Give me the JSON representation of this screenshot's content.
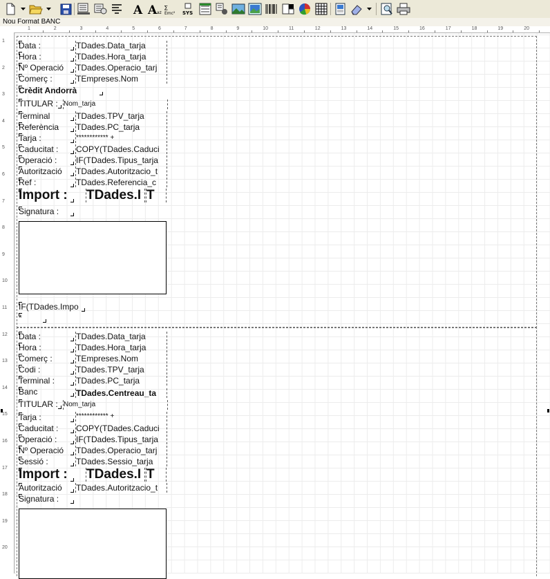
{
  "window": {
    "title": "Nou Format BANC"
  },
  "toolbar": {
    "icons": [
      "new-document-icon",
      "dropdown-arrow-icon",
      "open-folder-icon",
      "dropdown-arrow-icon",
      "save-icon",
      "report-properties-icon",
      "database-icon",
      "text-label-icon",
      "font-icon",
      "font-size-icon",
      "special-chars-icon",
      "system-field-icon",
      "list-icon",
      "dataset-icon",
      "image-icon",
      "picture-icon",
      "barcode-icon",
      "color-icon",
      "chart-icon",
      "grid-icon",
      "preview-icon",
      "eraser-icon",
      "dropdown-arrow-icon",
      "zoom-icon",
      "print-icon"
    ]
  },
  "ruler": {
    "h_marks": [
      "1",
      "2",
      "3",
      "4",
      "5",
      "6",
      "7",
      "8",
      "9",
      "10",
      "11",
      "12",
      "13",
      "14",
      "15",
      "16",
      "17",
      "18",
      "19",
      "20"
    ],
    "v_marks": [
      "1",
      "2",
      "3",
      "4",
      "5",
      "6",
      "7",
      "8",
      "9",
      "10",
      "11",
      "12",
      "13",
      "14",
      "15",
      "16",
      "17",
      "18",
      "19",
      "20"
    ]
  },
  "band1": {
    "rows": [
      {
        "label": "Data :",
        "field": "TDades.Data_tarja"
      },
      {
        "label": "Hora :",
        "field": "TDades.Hora_tarja"
      },
      {
        "label": "Nº Operació",
        "field": "TDades.Operacio_tarj"
      },
      {
        "label": "Comerç :",
        "field": "TEmpreses.Nom"
      }
    ],
    "bank": "Crèdit Andorrà",
    "titular_label": "TITULAR :",
    "titular_field": "Nom_tarja",
    "rows2": [
      {
        "label": "Terminal",
        "field": "TDades.TPV_tarja"
      },
      {
        "label": "Referència",
        "field": "TDades.PC_tarja"
      },
      {
        "label": "Tarja :",
        "field": "************ +"
      },
      {
        "label": "Caducitat :",
        "field": "COPY(TDades.Caduci"
      },
      {
        "label": "Operació :",
        "field": "IF(TDades.Tipus_tarja"
      },
      {
        "label": "Autorització",
        "field": "TDades.Autoritzacio_t"
      },
      {
        "label": "Ref :",
        "field": "TDades.Referencia_c"
      }
    ],
    "import_label": "Import :",
    "import_field": "TDades.I",
    "import_field2": "T",
    "signature_label": "Signatura :",
    "footer_field": "IF(TDades.Impo",
    "footer_field2": "*"
  },
  "band2": {
    "rows": [
      {
        "label": "Data :",
        "field": "TDades.Data_tarja"
      },
      {
        "label": "Hora :",
        "field": "TDades.Hora_tarja"
      },
      {
        "label": "Comerç :",
        "field": "TEmpreses.Nom"
      },
      {
        "label": "Codi :",
        "field": "TDades.TPV_tarja"
      },
      {
        "label": "Terminal :",
        "field": "TDades.PC_tarja"
      }
    ],
    "bank_label": "Banc",
    "bank_field": "TDades.Centreau_ta",
    "titular_label": "TITULAR :",
    "titular_field": "Nom_tarja",
    "rows2": [
      {
        "label": "Tarja :",
        "field": "************ +"
      },
      {
        "label": "Caducitat :",
        "field": "COPY(TDades.Caduci"
      },
      {
        "label": "Operació :",
        "field": "IF(TDades.Tipus_tarja"
      },
      {
        "label": "Nº Operació",
        "field": "TDades.Operacio_tarj"
      },
      {
        "label": "Sessió :",
        "field": "TDades.Sessio_tarja"
      }
    ],
    "import_label": "Import :",
    "import_field": "TDades.I",
    "import_field2": "T",
    "auth_label": "Autorització",
    "auth_field": "TDades.Autoritzacio_t",
    "signature_label": "Signatura :"
  }
}
